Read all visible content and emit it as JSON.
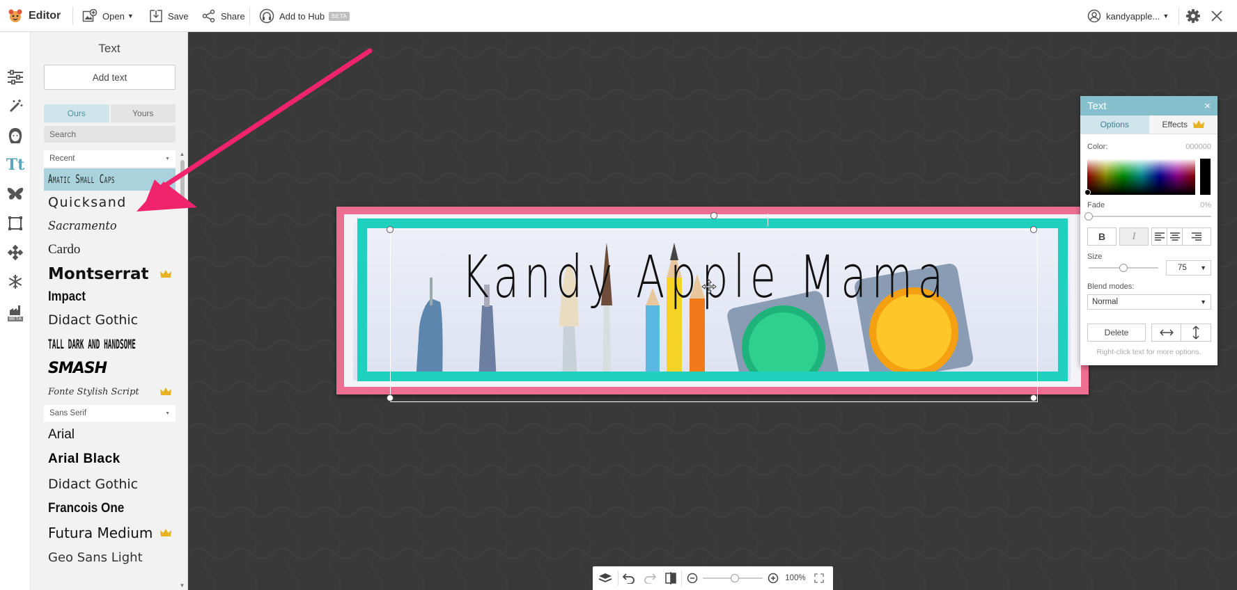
{
  "topbar": {
    "app_name": "Editor",
    "open_label": "Open",
    "save_label": "Save",
    "share_label": "Share",
    "hub_label": "Add to Hub",
    "hub_badge": "BETA",
    "user_name": "kandyapple..."
  },
  "rail": {
    "items": [
      "sliders-icon",
      "magic-wand-icon",
      "face-icon",
      "text-icon",
      "butterfly-icon",
      "frame-icon",
      "texture-icon",
      "snowflake-icon",
      "beta-tools-icon"
    ],
    "beta_label": "BETA",
    "active": "text-icon"
  },
  "text_panel": {
    "title": "Text",
    "add_text_label": "Add text",
    "tabs": [
      "Ours",
      "Yours"
    ],
    "active_tab": "Ours",
    "search_placeholder": "Search",
    "recent_category": "Recent",
    "recent_fonts": [
      {
        "name": "Amatic Small Caps",
        "selected": true,
        "premium": false
      },
      {
        "name": "Quicksand",
        "selected": false,
        "premium": false
      },
      {
        "name": "Sacramento",
        "selected": false,
        "premium": false
      },
      {
        "name": "Cardo",
        "selected": false,
        "premium": false
      },
      {
        "name": "Montserrat",
        "selected": false,
        "premium": true
      },
      {
        "name": "Impact",
        "selected": false,
        "premium": false
      },
      {
        "name": "Didact Gothic",
        "selected": false,
        "premium": false
      },
      {
        "name": "Tall Dark and Handsome",
        "selected": false,
        "premium": false
      },
      {
        "name": "SMASH",
        "selected": false,
        "premium": false
      },
      {
        "name": "Fonte Stylish Script",
        "selected": false,
        "premium": true
      }
    ],
    "sans_category": "Sans Serif",
    "sans_fonts": [
      {
        "name": "Arial",
        "premium": false
      },
      {
        "name": "Arial Black",
        "premium": false
      },
      {
        "name": "Didact Gothic",
        "premium": false
      },
      {
        "name": "Francois One",
        "premium": false
      },
      {
        "name": "Futura Medium",
        "premium": true
      },
      {
        "name": "Geo Sans Light",
        "premium": false
      }
    ]
  },
  "canvas": {
    "banner_text": "Kandy Apple Mama",
    "banner_border_color": "#ec6f92",
    "frame_color": "#1fd0bf"
  },
  "text_window": {
    "title": "Text",
    "close_label": "×",
    "tab_options": "Options",
    "tab_effects": "Effects",
    "color_label": "Color:",
    "color_value": "000000",
    "fade_label": "Fade",
    "fade_value": "0%",
    "fade_fraction": 0,
    "bold_label": "B",
    "italic_label": "I",
    "size_label": "Size",
    "size_value": "75",
    "blend_label": "Blend modes:",
    "blend_value": "Normal",
    "delete_label": "Delete",
    "hint": "Right-click text for more options."
  },
  "bottombar": {
    "zoom_value": "100%",
    "zoom_fraction": 0.5
  },
  "colors": {
    "accent": "#86bfcc",
    "premium_crown": "#e6b422",
    "annotation_arrow": "#f0246c"
  }
}
